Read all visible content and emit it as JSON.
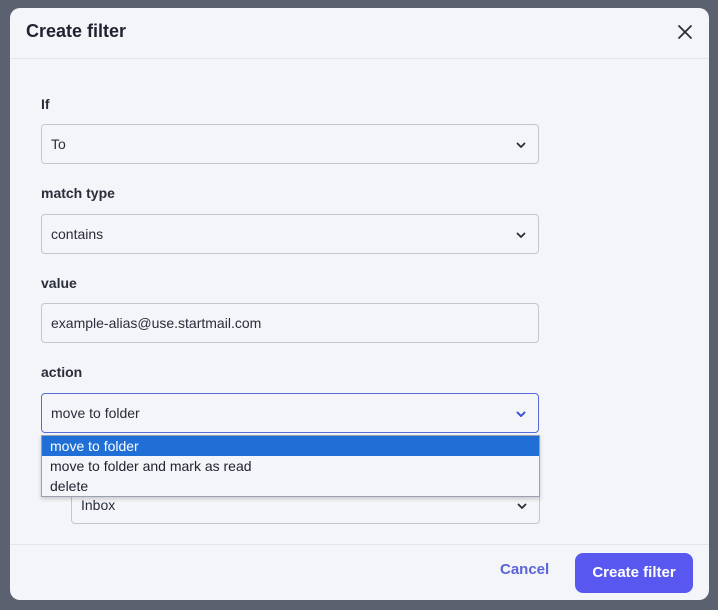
{
  "dialog": {
    "title": "Create filter",
    "close_icon": "close-icon"
  },
  "form": {
    "if_label": "If",
    "if_value": "To",
    "match_type_label": "match type",
    "match_type_value": "contains",
    "value_label": "value",
    "value_text": "example-alias@use.startmail.com",
    "action_label": "action",
    "action_value": "move to folder",
    "folder_value": "Inbox"
  },
  "action_options": [
    {
      "label": "move to folder",
      "selected": true
    },
    {
      "label": "move to folder and mark as read",
      "selected": false
    },
    {
      "label": "delete",
      "selected": false
    }
  ],
  "footer": {
    "cancel_label": "Cancel",
    "create_label": "Create filter"
  },
  "colors": {
    "accent": "#5858f0",
    "highlight": "#1f6fd6",
    "backdrop": "#5c6170"
  }
}
